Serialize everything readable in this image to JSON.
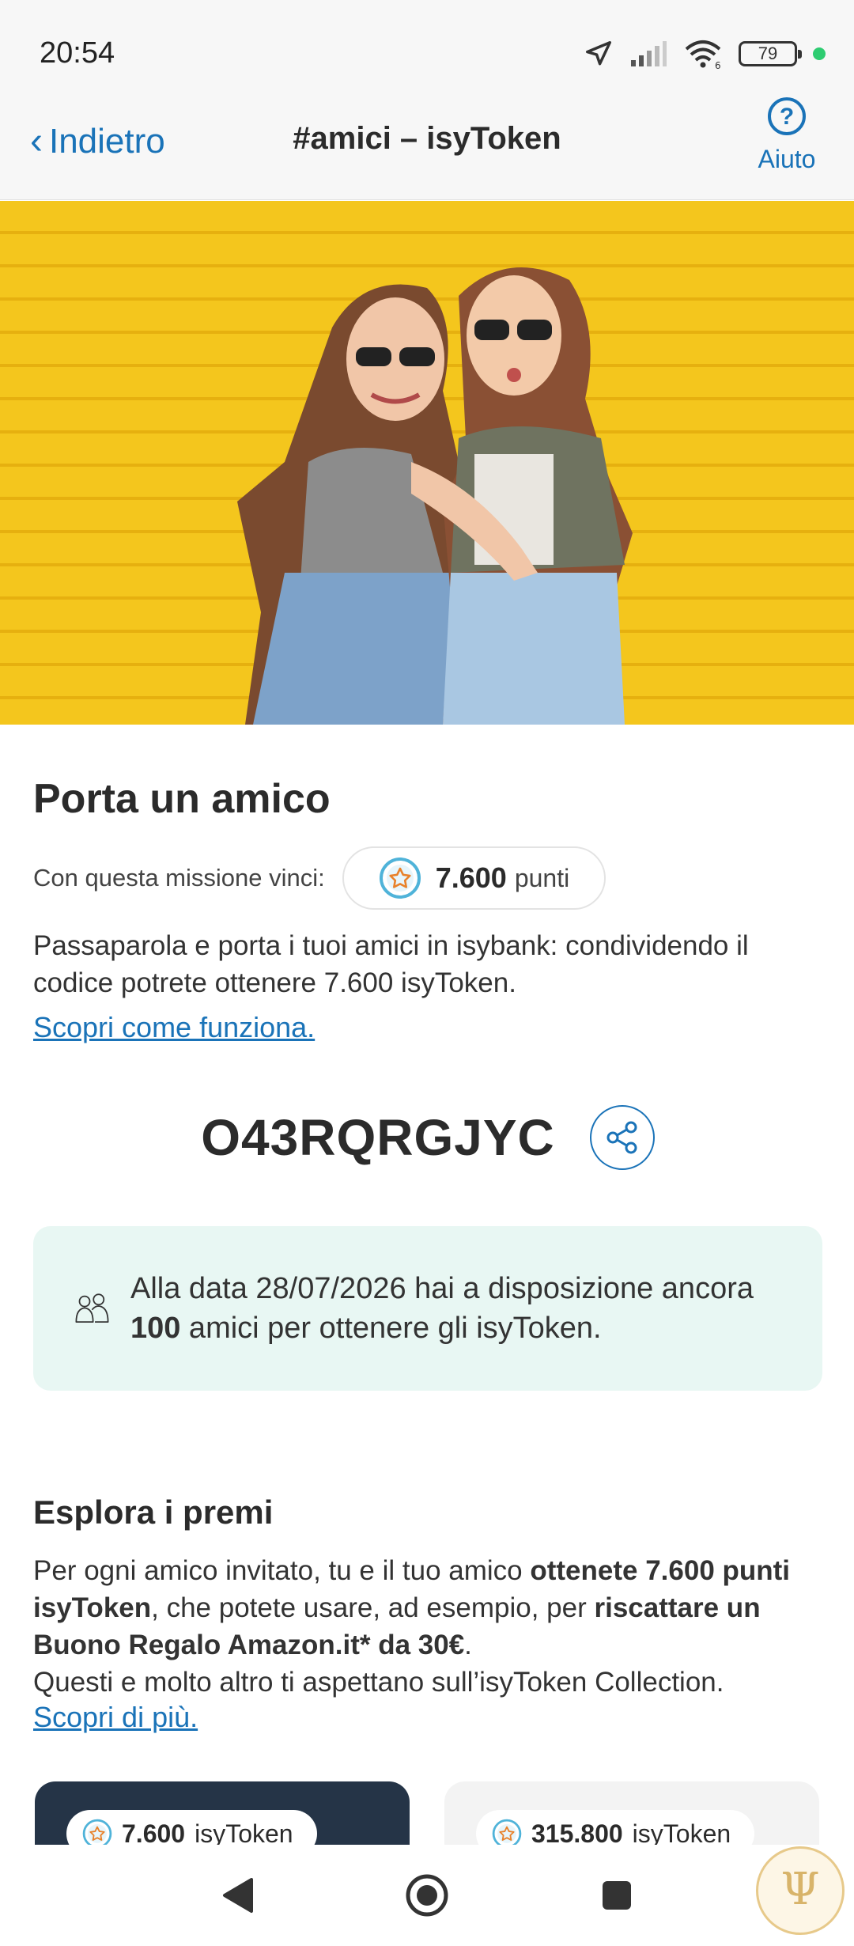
{
  "status_bar": {
    "time": "20:54",
    "battery": "79",
    "wifi_sub": "6"
  },
  "nav": {
    "back_label": "Indietro",
    "title": "#amici – isyToken",
    "help_label": "Aiuto"
  },
  "hero": {
    "image": "two-women-yellow-wall-photo"
  },
  "mission": {
    "heading": "Porta un amico",
    "reward_label": "Con questa missione vinci:",
    "points_value": "7.600",
    "points_unit": "punti",
    "description": "Passaparola e porta i tuoi amici in isybank: condividendo il codice potrete ottenere 7.600 isyToken.",
    "link": "Scopri come funziona."
  },
  "referral": {
    "code": "O43RQRGJYC"
  },
  "info_card": {
    "text_before": "Alla data 28/07/2026 hai a disposizione ancora ",
    "count": "100",
    "text_after": " amici per ottenere gli isyToken."
  },
  "rewards": {
    "heading": "Esplora i premi",
    "p1": "Per ogni amico invitato, tu e il tuo amico ",
    "p1_bold": "ottenete 7.600 punti isyToken",
    "p2": ", che potete usare, ad esempio, per ",
    "p2_bold": "riscattare un Buono Regalo Amazon.it* da 30€",
    "p3": ".",
    "p4": "Questi e molto altro ti aspettano sull’isyToken Collection.",
    "link": "Scopri di più.",
    "cards": [
      {
        "points": "7.600",
        "unit": "isyToken"
      },
      {
        "points": "315.800",
        "unit": "isyToken"
      }
    ]
  },
  "colors": {
    "accent": "#1a73b8",
    "info_bg": "#e8f7f3",
    "card_dark": "#253447",
    "hero_yellow": "#f4c61d"
  }
}
